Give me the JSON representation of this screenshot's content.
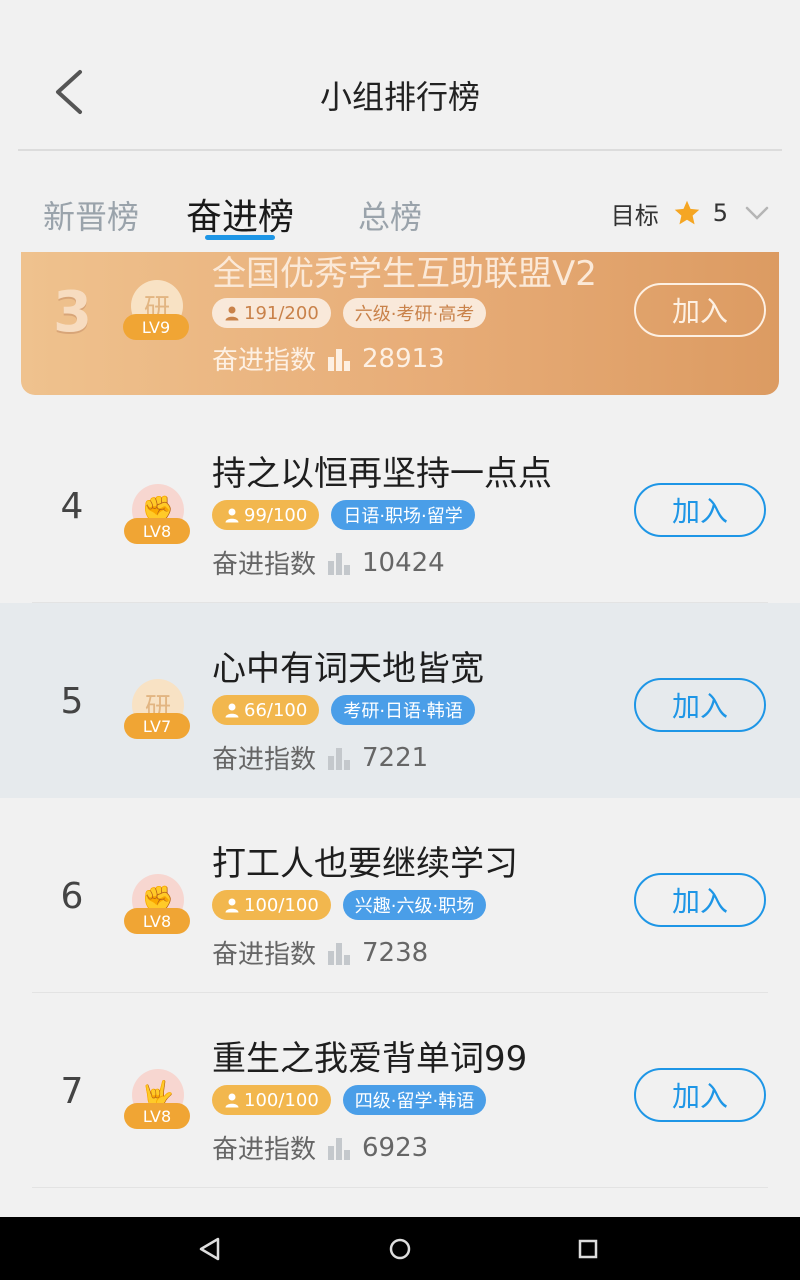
{
  "header": {
    "title": "小组排行榜"
  },
  "tabs": [
    {
      "label": "新晋榜"
    },
    {
      "label": "奋进榜"
    },
    {
      "label": "总榜"
    }
  ],
  "goal": {
    "label": "目标",
    "value": "5"
  },
  "score_label": "奋进指数",
  "join_label": "加入",
  "featured": {
    "rank": "3",
    "name": "全国优秀学生互助联盟V2",
    "avatar_glyph": "研",
    "level": "LV9",
    "members": "191/200",
    "tags": "六级·考研·高考",
    "score": "28913"
  },
  "groups": [
    {
      "rank": "4",
      "name": "持之以恒再坚持一点点",
      "avatar_glyph": "✊",
      "level": "LV8",
      "members": "99/100",
      "tags": "日语·职场·留学",
      "score": "10424"
    },
    {
      "rank": "5",
      "name": "心中有词天地皆宽",
      "avatar_glyph": "研",
      "level": "LV7",
      "members": "66/100",
      "tags": "考研·日语·韩语",
      "score": "7221"
    },
    {
      "rank": "6",
      "name": "打工人也要继续学习",
      "avatar_glyph": "✊",
      "level": "LV8",
      "members": "100/100",
      "tags": "兴趣·六级·职场",
      "score": "7238"
    },
    {
      "rank": "7",
      "name": "重生之我爱背单词99",
      "avatar_glyph": "🤟",
      "level": "LV8",
      "members": "100/100",
      "tags": "四级·留学·韩语",
      "score": "6923"
    }
  ],
  "colors": {
    "accent": "#1e96e6",
    "member_pill": "#f2b74e",
    "tag_pill": "#4a9ee8",
    "level_badge": "#f0a534"
  },
  "icons": {
    "back": "back-arrow-icon",
    "star": "star-icon",
    "dropdown": "chevron-down-icon",
    "members": "person-icon",
    "score": "bar-chart-icon"
  }
}
